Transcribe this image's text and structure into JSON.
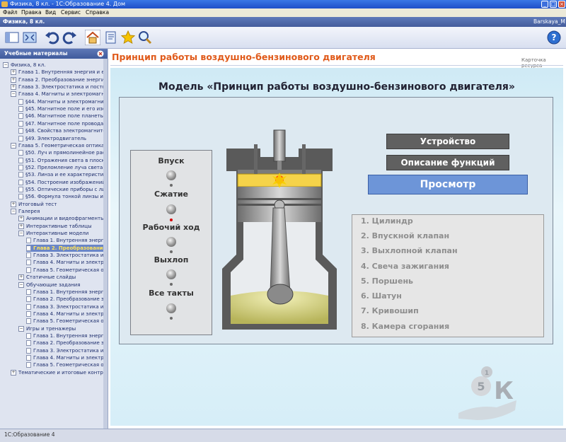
{
  "window": {
    "title": "Физика, 8 кл. - 1С:Образование 4. Дом",
    "user": "Barskaya_M",
    "course": "Физика, 8 кл."
  },
  "menu": [
    "Файл",
    "Правка",
    "Вид",
    "Сервис",
    "Справка"
  ],
  "sidebar": {
    "title": "Учебные материалы",
    "items": [
      {
        "label": "Физика, 8 кл.",
        "lvl": 0,
        "kind": "minus"
      },
      {
        "label": "Глава 1. Внутренняя энергия и ее",
        "lvl": 1,
        "kind": "plus"
      },
      {
        "label": "Глава 2. Преобразование энергии",
        "lvl": 1,
        "kind": "plus"
      },
      {
        "label": "Глава 3. Электростатика и постоян",
        "lvl": 1,
        "kind": "plus"
      },
      {
        "label": "Глава 4. Магниты и электромагнит",
        "lvl": 1,
        "kind": "minus"
      },
      {
        "label": "§44. Магниты и электромагниты",
        "lvl": 2,
        "kind": "doc"
      },
      {
        "label": "§45. Магнитное поле и его изоб",
        "lvl": 2,
        "kind": "doc"
      },
      {
        "label": "§46. Магнитное поле планеты З",
        "lvl": 2,
        "kind": "doc"
      },
      {
        "label": "§47. Магнитное поле провода с",
        "lvl": 2,
        "kind": "doc"
      },
      {
        "label": "§48. Свойства электромагнитов",
        "lvl": 2,
        "kind": "doc"
      },
      {
        "label": "§49. Электродвигатель",
        "lvl": 2,
        "kind": "doc"
      },
      {
        "label": "Глава 5. Геометрическая оптика",
        "lvl": 1,
        "kind": "minus"
      },
      {
        "label": "§50. Луч и прямолинейное рас",
        "lvl": 2,
        "kind": "doc"
      },
      {
        "label": "§51. Отражения света в плоско",
        "lvl": 2,
        "kind": "doc"
      },
      {
        "label": "§52. Преломление луча света",
        "lvl": 2,
        "kind": "doc"
      },
      {
        "label": "§53. Линза и ее характеристи",
        "lvl": 2,
        "kind": "doc"
      },
      {
        "label": "§54. Построение изображений",
        "lvl": 2,
        "kind": "doc"
      },
      {
        "label": "§55. Оптические приборы с лин",
        "lvl": 2,
        "kind": "doc"
      },
      {
        "label": "§56. Формула тонкой линзы и",
        "lvl": 2,
        "kind": "doc"
      },
      {
        "label": "Итоговый тест",
        "lvl": 1,
        "kind": "plus"
      },
      {
        "label": "Галерея",
        "lvl": 1,
        "kind": "minus"
      },
      {
        "label": "Анимации и видеофрагменты",
        "lvl": 2,
        "kind": "plus"
      },
      {
        "label": "Интерактивные таблицы",
        "lvl": 2,
        "kind": "plus"
      },
      {
        "label": "Интерактивные модели",
        "lvl": 2,
        "kind": "minus"
      },
      {
        "label": "Глава 1. Внутренняя энерги",
        "lvl": 3,
        "kind": "doc"
      },
      {
        "label": "Глава 2. Преобразование",
        "lvl": 3,
        "kind": "doc",
        "selected": true
      },
      {
        "label": "Глава 3. Электростатика и п",
        "lvl": 3,
        "kind": "doc"
      },
      {
        "label": "Глава 4. Магниты и электром",
        "lvl": 3,
        "kind": "doc"
      },
      {
        "label": "Глава 5. Геометрическая опт",
        "lvl": 3,
        "kind": "doc"
      },
      {
        "label": "Статичные слайды",
        "lvl": 2,
        "kind": "plus"
      },
      {
        "label": "Обучающие задания",
        "lvl": 2,
        "kind": "minus"
      },
      {
        "label": "Глава 1. Внутренняя энерги",
        "lvl": 3,
        "kind": "doc"
      },
      {
        "label": "Глава 2. Преобразование эн",
        "lvl": 3,
        "kind": "doc"
      },
      {
        "label": "Глава 3. Электростатика и п",
        "lvl": 3,
        "kind": "doc"
      },
      {
        "label": "Глава 4. Магниты и электро",
        "lvl": 3,
        "kind": "doc"
      },
      {
        "label": "Глава 5. Геометрическая оп",
        "lvl": 3,
        "kind": "doc"
      },
      {
        "label": "Игры и тренажеры",
        "lvl": 2,
        "kind": "minus"
      },
      {
        "label": "Глава 1. Внутренняя энерги",
        "lvl": 3,
        "kind": "doc"
      },
      {
        "label": "Глава 2. Преобразование эн",
        "lvl": 3,
        "kind": "doc"
      },
      {
        "label": "Глава 3. Электростатика и п",
        "lvl": 3,
        "kind": "doc"
      },
      {
        "label": "Глава 4. Магниты и электром",
        "lvl": 3,
        "kind": "doc"
      },
      {
        "label": "Глава 5. Геометрическая опт",
        "lvl": 3,
        "kind": "doc"
      },
      {
        "label": "Тематические и итоговые контр",
        "lvl": 1,
        "kind": "plus"
      }
    ]
  },
  "content": {
    "title": "Принцип работы воздушно-бензинового двигателя",
    "card_link": "Карточка ресурса",
    "model_title": "Модель «Принцип работы воздушно-бензинового двигателя»",
    "controls": [
      "Впуск",
      "Сжатие",
      "Рабочий ход",
      "Выхлоп",
      "Все такты"
    ],
    "buttons": {
      "device": "Устройство",
      "functions": "Описание функций",
      "view": "Просмотр"
    },
    "parts": [
      "1. Цилиндр",
      "2. Впускной клапан",
      "3. Выхлопной клапан",
      "4. Свеча зажигания",
      "5. Поршень",
      "6. Шатун",
      "7. Кривошип",
      "8. Камера сгорания"
    ],
    "logo": {
      "big": "5",
      "small": "1",
      "letter": "К"
    }
  },
  "status": "1С:Образование 4",
  "colors": {
    "accent": "#e05a1a",
    "button_dark": "#606060",
    "button_view": "#6d95d8"
  }
}
